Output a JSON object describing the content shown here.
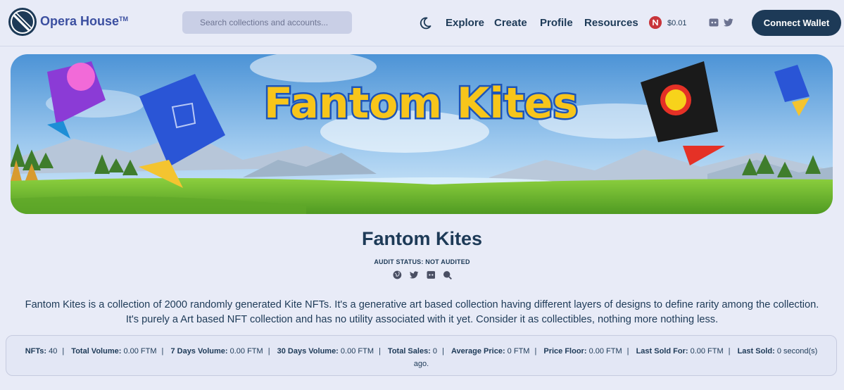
{
  "header": {
    "brand": "Opera House",
    "brand_tm": "TM",
    "search_placeholder": "Search collections and accounts...",
    "nav": [
      "Explore",
      "Create",
      "Profile",
      "Resources"
    ],
    "price": "$0.01",
    "connect_label": "Connect Wallet"
  },
  "banner": {
    "title": "Fantom Kites"
  },
  "collection": {
    "title": "Fantom Kites",
    "audit": "AUDIT STATUS: NOT AUDITED",
    "social_icons": [
      "globe-icon",
      "twitter-icon",
      "discord-icon",
      "search-icon"
    ],
    "description": "Fantom Kites is a collection of 2000 randomly generated Kite NFTs. It's a generative art based collection having different layers of designs to define rarity among the collection. It's purely a Art based NFT collection and has no utility associated with it yet. Consider it as collectibles, nothing more nothing less."
  },
  "stats": [
    {
      "label": "NFTs:",
      "value": "40"
    },
    {
      "label": "Total Volume:",
      "value": "0.00 FTM"
    },
    {
      "label": "7 Days Volume:",
      "value": "0.00 FTM"
    },
    {
      "label": "30 Days Volume:",
      "value": "0.00 FTM"
    },
    {
      "label": "Total Sales:",
      "value": "0"
    },
    {
      "label": "Average Price:",
      "value": "0 FTM"
    },
    {
      "label": "Price Floor:",
      "value": "0.00 FTM"
    },
    {
      "label": "Last Sold For:",
      "value": "0.00 FTM"
    },
    {
      "label": "Last Sold:",
      "value": "0 second(s) ago."
    }
  ],
  "colors": {
    "navy": "#1d3a57",
    "brand": "#3b4fa0",
    "background": "#e8ebf7",
    "banner_title": "#f7c51b"
  }
}
